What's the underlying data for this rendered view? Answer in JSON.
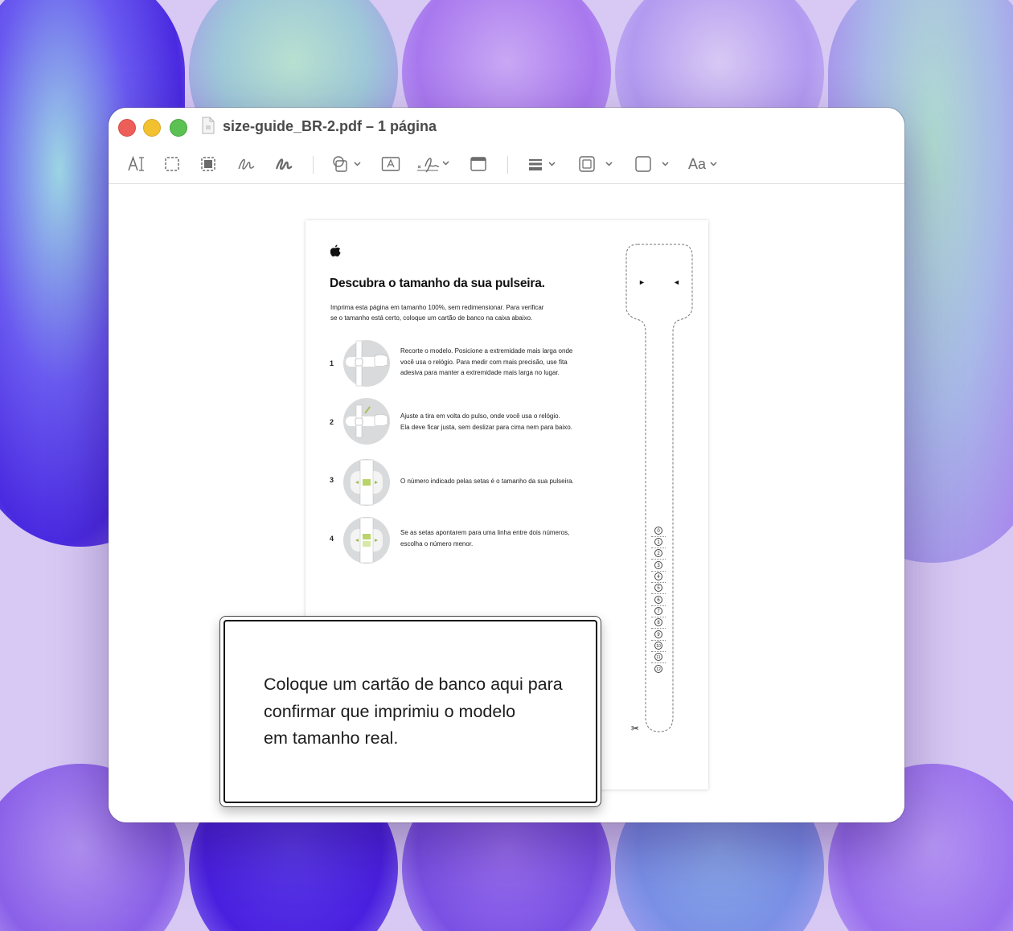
{
  "window": {
    "title": "size-guide_BR-2.pdf – 1 página"
  },
  "toolbar": {
    "tools": [
      {
        "name": "text-selection-tool",
        "icon": "text-cursor-icon"
      },
      {
        "name": "rectangular-selection-tool",
        "icon": "dashed-rectangle-icon"
      },
      {
        "name": "redact-tool",
        "icon": "redact-icon"
      },
      {
        "name": "sketch-tool",
        "icon": "sketch-icon"
      },
      {
        "name": "draw-tool",
        "icon": "draw-icon"
      },
      {
        "name": "shapes-tool",
        "icon": "shapes-icon"
      },
      {
        "name": "text-box-tool",
        "icon": "text-box-icon"
      },
      {
        "name": "sign-tool",
        "icon": "signature-icon"
      },
      {
        "name": "note-tool",
        "icon": "note-icon"
      },
      {
        "name": "shape-style-tool",
        "icon": "line-style-icon"
      },
      {
        "name": "border-color-tool",
        "icon": "border-color-icon"
      },
      {
        "name": "fill-color-tool",
        "icon": "fill-color-icon"
      },
      {
        "name": "text-style-tool",
        "icon": "text-style-icon",
        "label": "Aa"
      }
    ]
  },
  "document": {
    "heading": "Descubra o tamanho da sua pulseira.",
    "intro_lines": [
      "Imprima esta página em tamanho 100%, sem redimensionar. Para verificar",
      "se o tamanho está certo, coloque um cartão de banco na caixa abaixo."
    ],
    "steps": [
      {
        "number": "1",
        "lines": [
          "Recorte o modelo. Posicione a extremidade mais larga onde",
          "você usa o relógio. Para medir com mais precisão, use fita",
          "adesiva para manter a extremidade mais larga no lugar."
        ]
      },
      {
        "number": "2",
        "lines": [
          "Ajuste a tira em volta do pulso, onde você usa o relógio.",
          "Ela deve ficar justa, sem deslizar para cima nem para baixo."
        ]
      },
      {
        "number": "3",
        "lines": [
          "O número indicado pelas setas é o tamanho da sua pulseira."
        ]
      },
      {
        "number": "4",
        "lines": [
          "Se as setas apontarem para uma linha entre dois números,",
          "escolha o número menor."
        ]
      }
    ],
    "size_marks": [
      "0",
      "1",
      "2",
      "3",
      "4",
      "5",
      "6",
      "7",
      "8",
      "9",
      "10",
      "11",
      "12"
    ],
    "arrow_left": "►",
    "arrow_right": "◄",
    "scissors": "✂"
  },
  "card_box": {
    "lines": [
      "Coloque um cartão de banco aqui para",
      "confirmar que imprimiu o modelo",
      "em tamanho real."
    ]
  },
  "colors": {
    "close": "#ee5e58",
    "minimize": "#f2c130",
    "zoom": "#5ac152",
    "wallpaper": "#d7c8f4"
  }
}
